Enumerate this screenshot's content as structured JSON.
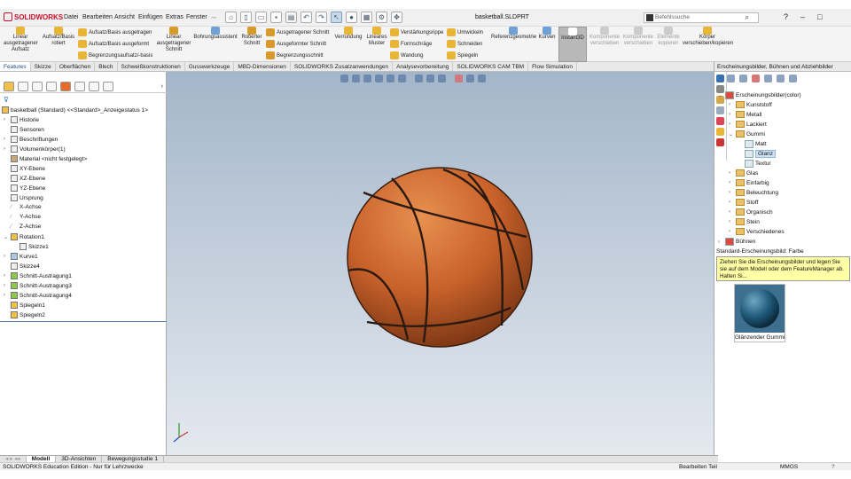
{
  "app": {
    "brand": "SOLIDWORKS",
    "doc_title": "basketball.SLDPRT"
  },
  "menu": [
    "Datei",
    "Bearbeiten",
    "Ansicht",
    "Einfügen",
    "Extras",
    "Fenster"
  ],
  "search": {
    "placeholder": "Befehlssuche"
  },
  "ribbon": {
    "linear": "Linear ausgetragener Aufsatz",
    "aufsatz_basis": "Aufsatz/Basis rotiert",
    "aufsatz_ausgetragen": "Aufsatz/Basis ausgetragen",
    "aufsatz_ausgeformt": "Aufsatz/Basis ausgeformt",
    "begrenzungsaufsatz": "Begrenzungsaufsatz/-basis",
    "linear_schnitt": "Linear ausgetragener Schnitt",
    "bohrungsassistent": "Bohrungsassistent",
    "rotierter_schnitt": "Rotierter Schnitt",
    "ausgetragener_schnitt": "Ausgetragener Schnitt",
    "ausgeformter_schnitt": "Ausgeformter Schnitt",
    "begrenzungsschnitt": "Begrenzungsschnitt",
    "verrundung": "Verrundung",
    "lineares_muster": "Lineares Muster",
    "verstaerkungsrippe": "Verstärkungsrippe",
    "formschraege": "Formschräge",
    "wandung": "Wandung",
    "umwickeln": "Umwickeln",
    "schneiden": "Schneiden",
    "spiegeln": "Spiegeln",
    "referenzgeometrie": "Referenzgeometrie",
    "kurven": "Kurven",
    "instant3d": "Instant3D",
    "komp_verschieben": "Komponente verschieben",
    "komp_verschieben2": "Komponente verschieben",
    "elemente_kopieren": "Elemente kopieren",
    "koerper": "Körper verschieben/kopieren"
  },
  "tabs": [
    "Features",
    "Skizze",
    "Oberflächen",
    "Blech",
    "Schweißkonstruktionen",
    "Gusswerkzeuge",
    "MBD-Dimensionen",
    "SOLIDWORKS Zusatzanwendungen",
    "Analysevorbereitung",
    "SOLIDWORKS CAM TBM",
    "Flow Simulation"
  ],
  "tree": {
    "root": "basketball (Standard) <<Standard>_Anzeigestatus 1>",
    "items": [
      "Historie",
      "Sensoren",
      "Beschriftungen",
      "Volumenkörper(1)",
      "Material <nicht festgelegt>",
      "XY-Ebene",
      "XZ-Ebene",
      "YZ-Ebene",
      "Ursprung",
      "X-Achse",
      "Y-Achse",
      "Z-Achse",
      "Rotation1",
      "Skizze1",
      "Kurve1",
      "Skizze4",
      "Schnitt-Austragung1",
      "Schnitt-Austragung3",
      "Schnitt-Austragung4",
      "Spiegeln1",
      "Spiegeln2"
    ]
  },
  "rightpanel": {
    "header": "Erscheinungsbilder, Bühnen und Abziehbilder",
    "tree": [
      "Erscheinungsbilder(color)",
      "Kunststoff",
      "Metall",
      "Lackiert",
      "Gummi",
      "Matt",
      "Glanz",
      "Textur",
      "Glas",
      "Einfarbig",
      "Beleuchtung",
      "Stoff",
      "Organisch",
      "Stein",
      "Verschiedenes",
      "Bühnen"
    ],
    "default_label": "Standard-Erscheinungsbild: Farbe",
    "tooltip": "Ziehen Sie die Erscheinungsbilder und legen Sie sie auf dem Modell oder dem FeatureManager ab. Halten Si...",
    "swatch_label": "Glänzender Gummi"
  },
  "bottom_tabs": [
    "Modell",
    "3D-Ansichten",
    "Bewegungsstudie 1"
  ],
  "status": {
    "left": "SOLIDWORKS Education Edition - Nur für Lehrzwecke",
    "mid": "Bearbeiten Teil",
    "units": "MMGS"
  },
  "colors": {
    "ball": "#c8612a",
    "seam": "#2a1a12",
    "tooltip": "#ffffa6",
    "brand": "#c8102e"
  }
}
